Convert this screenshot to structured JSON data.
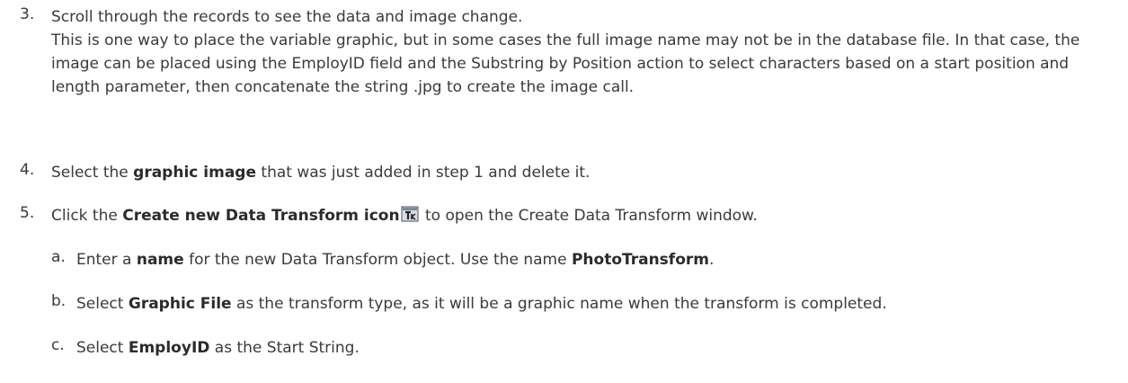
{
  "steps": [
    {
      "num": "3.",
      "text": "Scroll through the records to see the data and image change.",
      "note": "This is one way to place the variable graphic, but in some cases the full image name may not be in the database file. In that case, the image can be placed using the EmployID field and the Substring by Position action to select characters based on a start position and length parameter, then concatenate the string .jpg to create the image call."
    },
    {
      "num": "4.",
      "pre": "Select the ",
      "bold": "graphic image",
      "post": " that was just added in step 1 and delete it."
    },
    {
      "num": "5.",
      "pre": "Click the ",
      "bold": "Create new Data Transform icon",
      "icon": "data-transform-icon",
      "post": " to open the Create Data Transform window.",
      "substeps": [
        {
          "num": "a.",
          "pre": "Enter a ",
          "bold": "name",
          "mid": " for the new Data Transform object. Use the name ",
          "bold2": "PhotoTransform",
          "post": "."
        },
        {
          "num": "b.",
          "pre": "Select ",
          "bold": "Graphic File",
          "post": " as the transform type, as it will be a graphic name when the transform is completed."
        },
        {
          "num": "c.",
          "pre": "Select ",
          "bold": "EmployID",
          "post": " as the Start String."
        }
      ]
    }
  ]
}
